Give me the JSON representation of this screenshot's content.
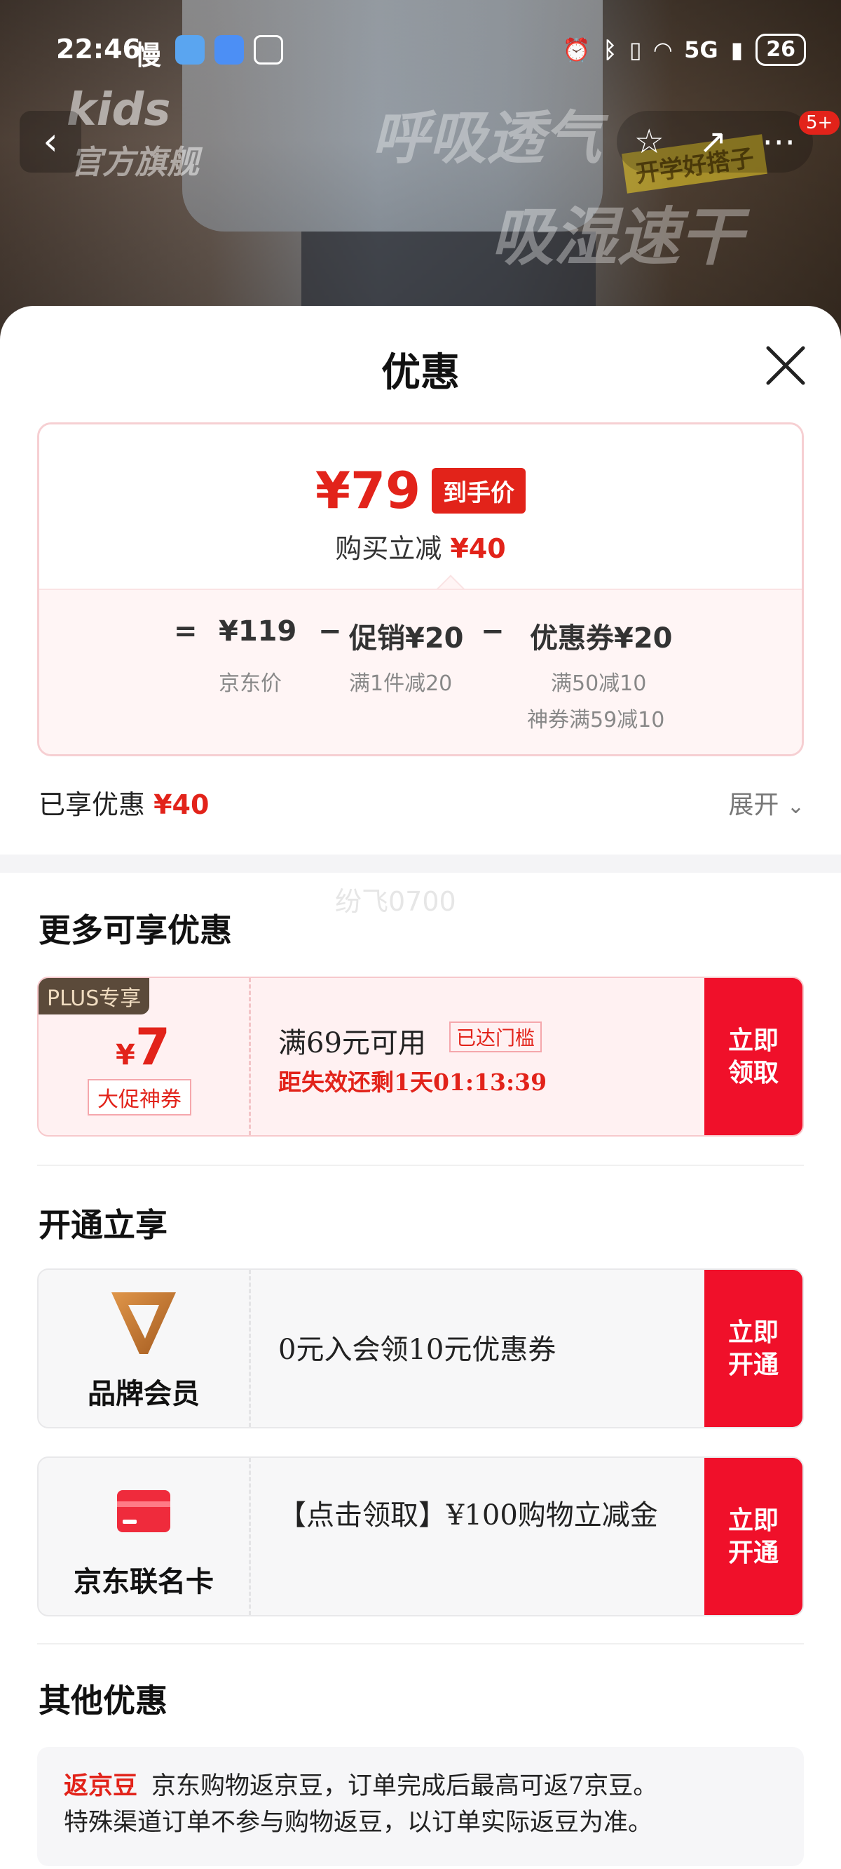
{
  "status_bar": {
    "time": "22:46",
    "slow_label": "慢",
    "network": "5G",
    "battery": "26"
  },
  "banner": {
    "brand_logo": "kids",
    "brand_sub": "官方旗舰",
    "ad_line1": "呼吸透气",
    "ad_line2": "吸湿速干",
    "ad_tag": "开学好搭子",
    "cart_badge": "5+"
  },
  "sheet": {
    "title": "优惠",
    "price": {
      "final": "¥79",
      "final_tag": "到手价",
      "save_label": "购买立减",
      "save_value": "¥40",
      "formula": {
        "equals": "=",
        "jd_price": "¥119",
        "jd_price_label": "京东价",
        "minus1": "−",
        "promo": "促销¥20",
        "promo_sub": "满1件减20",
        "minus2": "−",
        "coupon": "优惠券¥20",
        "coupon_sub1": "满50减10",
        "coupon_sub2": "神券满59减10"
      }
    },
    "enjoyed_label": "已享优惠",
    "enjoyed_value": "¥40",
    "expand_label": "展开",
    "watermark": "纷飞0700",
    "more_title": "更多可享优惠",
    "coupon": {
      "plus_tag": "PLUS专享",
      "currency": "¥",
      "amount": "7",
      "kind": "大促神券",
      "condition": "满69元可用",
      "reached": "已达门槛",
      "expire": "距失效还剩1天01:13:39",
      "button": "立即\n领取"
    },
    "open_title": "开通立享",
    "open_items": [
      {
        "label": "品牌会员",
        "desc": "0元入会领10元优惠券",
        "button": "立即\n开通",
        "icon": "brand-member-logo-icon"
      },
      {
        "label": "京东联名卡",
        "desc": "【点击领取】¥100购物立减金",
        "button": "立即\n开通",
        "icon": "credit-card-icon"
      }
    ],
    "other_title": "其他优惠",
    "other": {
      "tag": "返京豆",
      "line1": "京东购物返京豆，订单完成后最高可返7京豆。",
      "line2": "特殊渠道订单不参与购物返豆，以订单实际返豆为准。"
    }
  },
  "colors": {
    "accent": "#e2231a",
    "button_red": "#f0102a",
    "plus_brown": "#5b4a3a"
  }
}
